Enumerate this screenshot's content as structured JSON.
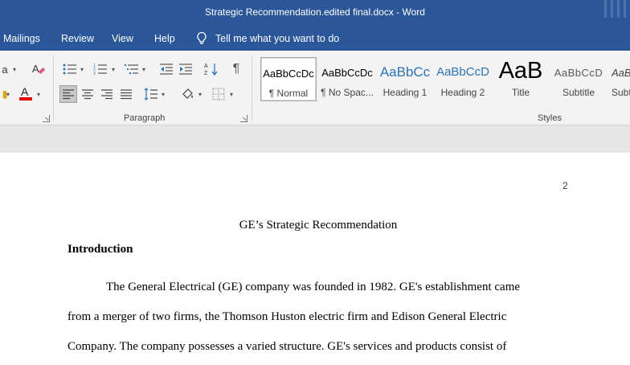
{
  "window": {
    "title": "Strategic Recommendation.edited  final.docx  -  Word"
  },
  "tabs": [
    "Mailings",
    "Review",
    "View",
    "Help"
  ],
  "tell_me": {
    "label": "Tell me what you want to do"
  },
  "ribbon": {
    "paragraph_group_label": "Paragraph",
    "styles_group_label": "Styles",
    "styles": [
      {
        "preview": "AaBbCcDc",
        "name": "¶ Normal",
        "selected": true
      },
      {
        "preview": "AaBbCcDc",
        "name": "¶ No Spac..."
      },
      {
        "preview": "AaBbCc",
        "name": "Heading 1"
      },
      {
        "preview": "AaBbCcD",
        "name": "Heading 2"
      },
      {
        "preview": "AaB",
        "name": "Title"
      },
      {
        "preview": "AaBbCcD",
        "name": "Subtitle"
      },
      {
        "preview": "AaBl",
        "name": "Subtl"
      }
    ]
  },
  "colors": {
    "brand": "#2b579a",
    "font_color_bar": "#e00000",
    "heading_blue": "#2e74b5"
  },
  "document": {
    "page_number": "2",
    "title": "GE’s Strategic Recommendation",
    "heading": "Introduction",
    "lines": [
      "The General Electrical (GE) company was founded in 1982. GE's establishment came",
      "from a merger of two firms, the Thomson Huston electric firm and Edison General Electric",
      "Company. The company possesses a varied structure. GE's services and products consist of"
    ]
  }
}
